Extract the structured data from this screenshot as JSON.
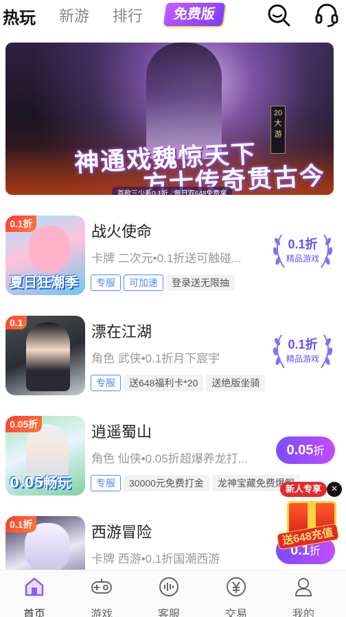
{
  "top_tabs": [
    {
      "label": "热玩",
      "active": true
    },
    {
      "label": "新游",
      "active": false
    },
    {
      "label": "排行",
      "active": false
    }
  ],
  "free_badge": "免费版",
  "top_icons": [
    "search-icon",
    "headset-icon"
  ],
  "banner": {
    "title_line1": "神通戏魏惊天下",
    "title_line2": "方士传奇贯古今",
    "subline": "首款三少系0.1折 · 每日双648免费拿",
    "side_tag": "20大游"
  },
  "games": [
    {
      "name": "战火使命",
      "desc": "卡牌 二次元•0.1折送可触碰...",
      "cover_badge": "0.1折",
      "cover_caption": "夏日狂潮季",
      "tags": [
        {
          "text": "专服",
          "style": "outline"
        },
        {
          "text": "可加速",
          "style": "outline"
        },
        {
          "text": "登录送无限抽",
          "style": "gray"
        }
      ],
      "discount": "0.1折",
      "discount_style": "laurel",
      "discount_sub": "精品游戏"
    },
    {
      "name": "漂在江湖",
      "desc": "角色 武侠•0.1折月下宸宇",
      "cover_badge": "0.1",
      "cover_caption": "",
      "tags": [
        {
          "text": "专服",
          "style": "outline"
        },
        {
          "text": "送648福利卡*20",
          "style": "gray"
        },
        {
          "text": "送绝版坐骑",
          "style": "gray"
        }
      ],
      "discount": "0.1折",
      "discount_style": "laurel",
      "discount_sub": "精品游戏"
    },
    {
      "name": "逍遥蜀山",
      "desc": "角色 仙侠•0.05折超爆养龙打...",
      "cover_badge": "0.05折",
      "cover_caption": "0.05畅玩",
      "tags": [
        {
          "text": "专服",
          "style": "outline"
        },
        {
          "text": "30000元免费打金",
          "style": "gray"
        },
        {
          "text": "龙神宝藏免费爆鲲",
          "style": "gray"
        }
      ],
      "discount_num": "0.05",
      "discount_unit": "折",
      "discount_style": "pill"
    },
    {
      "name": "西游冒险",
      "desc": "卡牌 西游•0.1折国潮西游",
      "cover_badge": "0.1折",
      "cover_caption": "",
      "tags": [],
      "discount_num": "0.1",
      "discount_unit": "折",
      "discount_style": "pill"
    }
  ],
  "promo": {
    "head": "新人专享",
    "amount": "送648充值",
    "close": "×"
  },
  "bottom_nav": [
    {
      "label": "首页",
      "icon": "home-icon",
      "active": true
    },
    {
      "label": "游戏",
      "icon": "gamepad-icon",
      "active": false
    },
    {
      "label": "客服",
      "icon": "customer-service-icon",
      "active": false
    },
    {
      "label": "交易",
      "icon": "yuan-icon",
      "active": false
    },
    {
      "label": "我的",
      "icon": "profile-icon",
      "active": false
    }
  ],
  "colors": {
    "accent": "#7a4cff",
    "tag_blue": "#4c8bf5",
    "home_icon": "#8a5cff"
  }
}
